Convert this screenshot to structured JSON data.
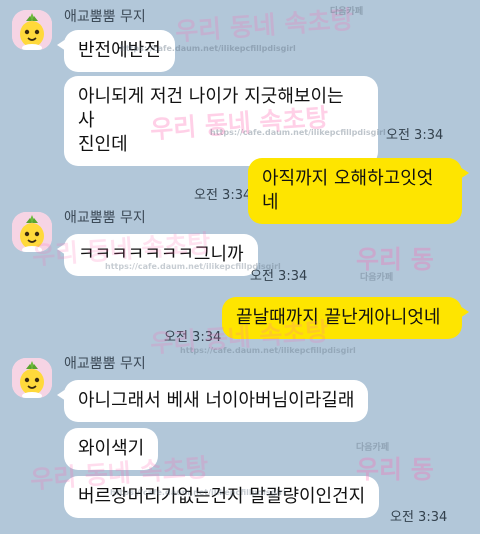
{
  "chat": {
    "groups": [
      {
        "sender": "애교뿜뿜 무지",
        "messages": [
          {
            "text": "반전에반전"
          },
          {
            "text": "아니되게 저건 나이가 지긋해보이는 사\n진인데",
            "time": "오전 3:34"
          }
        ]
      },
      {
        "mine": true,
        "messages": [
          {
            "text": "아직까지 오해하고잇엇네",
            "time": "오전 3:34"
          }
        ]
      },
      {
        "sender": "애교뿜뿜 무지",
        "messages": [
          {
            "text": "ㅋㅋㅋㅋㅋㅋㅋ그니까",
            "time": "오전 3:34"
          }
        ]
      },
      {
        "mine": true,
        "messages": [
          {
            "text": "끝날때까지 끝난게아니엇네",
            "time": "오전 3:34"
          }
        ]
      },
      {
        "sender": "애교뿜뿜 무지",
        "messages": [
          {
            "text": "아니그래서 베새 너이아버님이라길래"
          },
          {
            "text": "와이색기"
          },
          {
            "text": "버르장머리가없는건지 말괄량이인건지",
            "time": "오전 3:34"
          }
        ]
      }
    ]
  },
  "watermark": {
    "brand": "우리 동네 속초탕",
    "brand_short": "우리 동",
    "cafe_label": "다음카페",
    "url": "https://cafe.daum.net/ilikepcfillpdisgirl",
    "colors": [
      "#ff66b2",
      "#ffe033",
      "#5ec4ff"
    ]
  },
  "colors": {
    "background": "#b2c7d9",
    "mine_bubble": "#fee500",
    "other_bubble": "#ffffff"
  }
}
